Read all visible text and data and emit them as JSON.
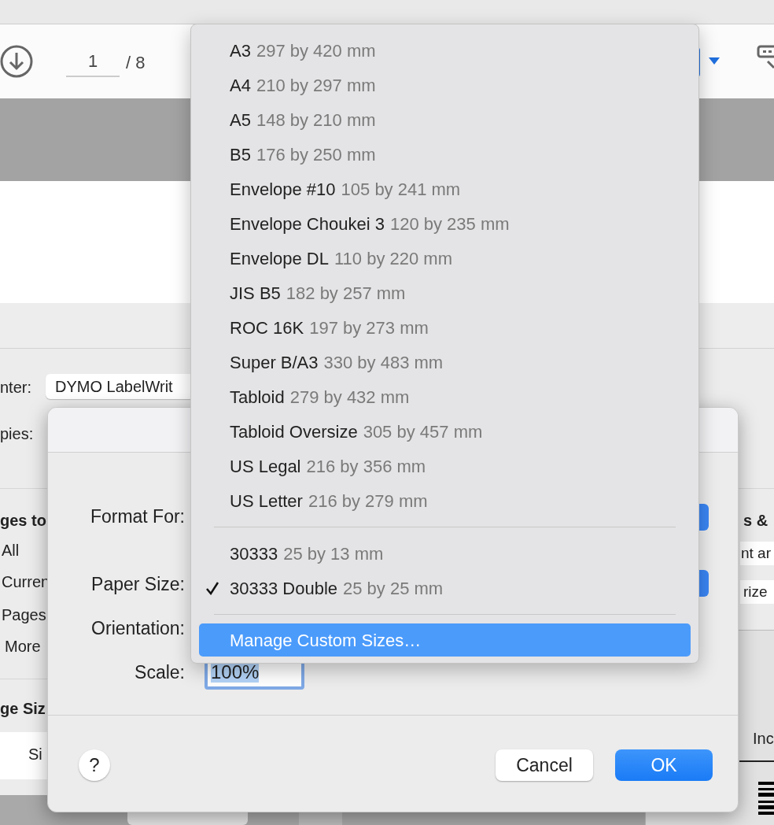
{
  "toolbar": {
    "page_field": "1",
    "page_total": "/ 8"
  },
  "print_panel": {
    "printer_label": "nter:",
    "printer_value": "DYMO LabelWrit",
    "copies_label": "pies:",
    "pages_heading": "ges to",
    "page_options": [
      {
        "label": "All"
      },
      {
        "label": "Curren"
      },
      {
        "label": "Pages"
      },
      {
        "label": "More"
      }
    ],
    "page_size_heading": "ge Siz",
    "size_tab": "Si",
    "right_heading": "s &",
    "right_field_1": "nt ar",
    "right_field_2": "rize",
    "right_tab": "Inc"
  },
  "dialog": {
    "labels": [
      "Format For:",
      "Paper Size:",
      "Orientation:",
      "Scale:"
    ],
    "scale_value": "100%",
    "help": "?",
    "buttons": [
      {
        "label": "Cancel",
        "kind": "secondary"
      },
      {
        "label": "OK",
        "kind": "primary"
      }
    ]
  },
  "menu": {
    "groups": [
      [
        {
          "name": "A3",
          "dims": "297 by 420 mm",
          "checked": false,
          "selected": false
        },
        {
          "name": "A4",
          "dims": "210 by 297 mm",
          "checked": false,
          "selected": false
        },
        {
          "name": "A5",
          "dims": "148 by 210 mm",
          "checked": false,
          "selected": false
        },
        {
          "name": "B5",
          "dims": "176 by 250 mm",
          "checked": false,
          "selected": false
        },
        {
          "name": "Envelope #10",
          "dims": "105 by 241 mm",
          "checked": false,
          "selected": false
        },
        {
          "name": "Envelope Choukei 3",
          "dims": "120 by 235 mm",
          "checked": false,
          "selected": false
        },
        {
          "name": "Envelope DL",
          "dims": "110 by 220 mm",
          "checked": false,
          "selected": false
        },
        {
          "name": "JIS B5",
          "dims": "182 by 257 mm",
          "checked": false,
          "selected": false
        },
        {
          "name": "ROC 16K",
          "dims": "197 by 273 mm",
          "checked": false,
          "selected": false
        },
        {
          "name": "Super B/A3",
          "dims": "330 by 483 mm",
          "checked": false,
          "selected": false
        },
        {
          "name": "Tabloid",
          "dims": "279 by 432 mm",
          "checked": false,
          "selected": false
        },
        {
          "name": "Tabloid Oversize",
          "dims": "305 by 457 mm",
          "checked": false,
          "selected": false
        },
        {
          "name": "US Legal",
          "dims": "216 by 356 mm",
          "checked": false,
          "selected": false
        },
        {
          "name": "US Letter",
          "dims": "216 by 279 mm",
          "checked": false,
          "selected": false
        }
      ],
      [
        {
          "name": "30333",
          "dims": "25 by 13 mm",
          "checked": false,
          "selected": false
        },
        {
          "name": "30333 Double",
          "dims": "25 by 25 mm",
          "checked": true,
          "selected": false
        }
      ],
      [
        {
          "name": "Manage Custom Sizes…",
          "checked": false,
          "selected": true
        }
      ]
    ]
  }
}
